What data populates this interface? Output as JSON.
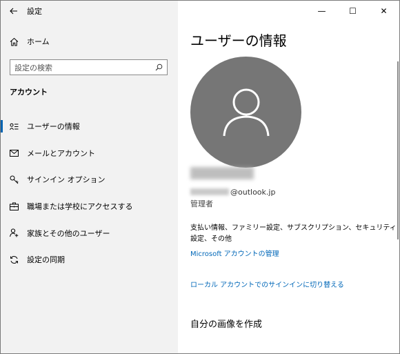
{
  "app": {
    "title": "設定"
  },
  "nav": {
    "back_icon": "back-arrow-icon",
    "home_label": "ホーム",
    "search_placeholder": "設定の検索",
    "section_title": "アカウント",
    "items": [
      {
        "label": "ユーザーの情報",
        "icon": "user-info-icon",
        "selected": true
      },
      {
        "label": "メールとアカウント",
        "icon": "mail-icon",
        "selected": false
      },
      {
        "label": "サインイン オプション",
        "icon": "key-icon",
        "selected": false
      },
      {
        "label": "職場または学校にアクセスする",
        "icon": "briefcase-icon",
        "selected": false
      },
      {
        "label": "家族とその他のユーザー",
        "icon": "person-add-icon",
        "selected": false
      },
      {
        "label": "設定の同期",
        "icon": "sync-icon",
        "selected": false
      }
    ]
  },
  "window_controls": {
    "minimize": "—",
    "maximize": "☐",
    "close": "✕"
  },
  "content": {
    "page_title": "ユーザーの情報",
    "email_domain": "@outlook.jp",
    "role": "管理者",
    "billing_text": "支払い情報、ファミリー設定、サブスクリプション、セキュリティ設定、その他",
    "manage_link": "Microsoft アカウントの管理",
    "local_account_link": "ローカル アカウントでのサインインに切り替える",
    "picture_heading": "自分の画像を作成"
  },
  "colors": {
    "accent": "#0063b1",
    "link": "#0067b8",
    "left_pane_bg": "#f2f2f2",
    "avatar_bg": "#767676"
  }
}
